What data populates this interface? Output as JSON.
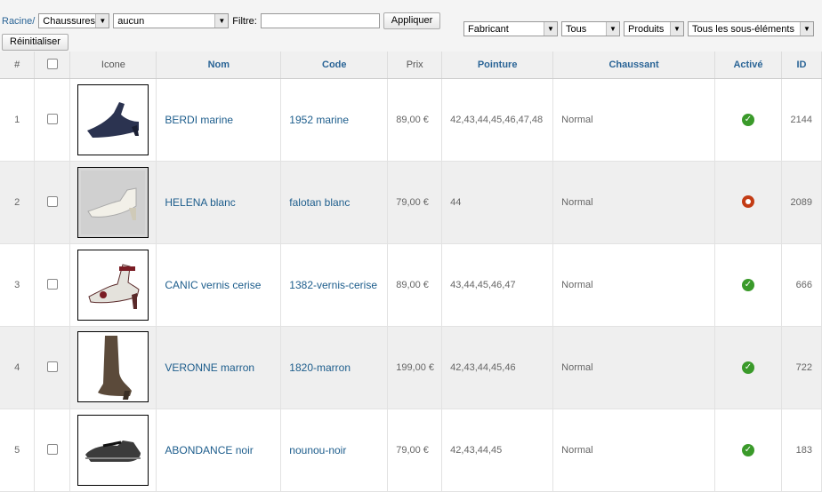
{
  "toolbar": {
    "breadcrumb": "Racine/",
    "category_select": "Chaussures",
    "subcategory_select": "aucun",
    "filter_label": "Filtre:",
    "filter_value": "",
    "apply_button": "Appliquer",
    "reset_button": "Réinitialiser",
    "manufacturer_select": "Fabricant",
    "all_select": "Tous",
    "products_select": "Produits",
    "subelements_select": "Tous les sous-éléments"
  },
  "columns": {
    "num": "#",
    "icon": "Icone",
    "name": "Nom",
    "code": "Code",
    "price": "Prix",
    "size": "Pointure",
    "fit": "Chaussant",
    "active": "Activé",
    "id": "ID"
  },
  "rows": [
    {
      "num": "1",
      "name": "BERDI marine",
      "code": "1952 marine",
      "price": "89,00 €",
      "size": "42,43,44,45,46,47,48",
      "fit": "Normal",
      "active": true,
      "id": "2144",
      "icon": "shoe-pump-navy-icon"
    },
    {
      "num": "2",
      "name": "HELENA blanc",
      "code": "falotan blanc",
      "price": "79,00 €",
      "size": "44",
      "fit": "Normal",
      "active": false,
      "id": "2089",
      "icon": "sandal-white-icon"
    },
    {
      "num": "3",
      "name": "CANIC vernis cerise",
      "code": "1382-vernis-cerise",
      "price": "89,00 €",
      "size": "43,44,45,46,47",
      "fit": "Normal",
      "active": true,
      "id": "666",
      "icon": "sandal-cherry-icon"
    },
    {
      "num": "4",
      "name": "VERONNE marron",
      "code": "1820-marron",
      "price": "199,00 €",
      "size": "42,43,44,45,46",
      "fit": "Normal",
      "active": true,
      "id": "722",
      "icon": "boot-brown-icon"
    },
    {
      "num": "5",
      "name": "ABONDANCE noir",
      "code": "nounou-noir",
      "price": "79,00 €",
      "size": "42,43,44,45",
      "fit": "Normal",
      "active": true,
      "id": "183",
      "icon": "shoe-strap-black-icon"
    }
  ],
  "colors": {
    "link": "#1d5d8c",
    "active": "#3a9a2a",
    "inactive": "#c33c15"
  }
}
